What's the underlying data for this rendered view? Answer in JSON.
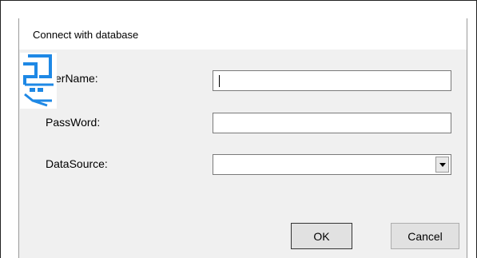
{
  "dialog": {
    "title": "Connect with database"
  },
  "form": {
    "username_label": "erName:",
    "username_value": "",
    "password_label": "PassWord:",
    "password_value": "",
    "datasource_label": "DataSource:",
    "datasource_value": ""
  },
  "buttons": {
    "ok_label": "OK",
    "cancel_label": "Cancel"
  },
  "overlay_icon": {
    "name": "screenshot-tool-icon",
    "color": "#1e88e5"
  }
}
